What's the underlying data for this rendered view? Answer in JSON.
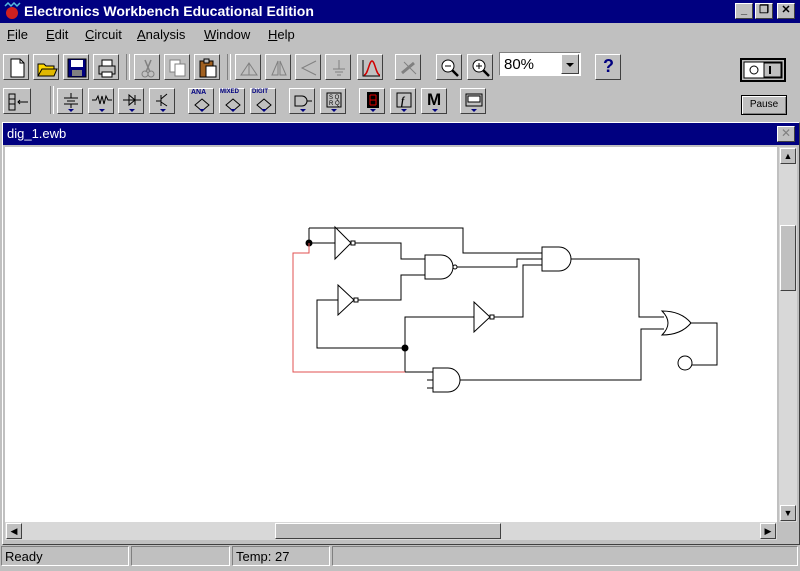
{
  "window": {
    "title": "Electronics Workbench Educational Edition",
    "controls": {
      "minimize": "_",
      "restore": "❐",
      "close": "✕"
    }
  },
  "menu": [
    {
      "key": "F",
      "rest": "ile"
    },
    {
      "key": "E",
      "rest": "dit"
    },
    {
      "key": "C",
      "rest": "ircuit"
    },
    {
      "key": "A",
      "rest": "nalysis"
    },
    {
      "key": "W",
      "rest": "indow"
    },
    {
      "key": "H",
      "rest": "elp"
    }
  ],
  "toolbar": {
    "zoom_value": "80%",
    "help_label": "?",
    "pause_label": "Pause"
  },
  "parts_bin": {
    "analog_label": "ANA",
    "mixed_label": "MIXED",
    "digital_label": "DIGIT",
    "misc_label": "M"
  },
  "document": {
    "title": "dig_1.ewb"
  },
  "status": {
    "message": "Ready",
    "middle": "",
    "temp": "Temp: 27"
  },
  "colors": {
    "titlebar": "#000080",
    "chrome": "#c0c0c0",
    "red_wire": "#e05050"
  }
}
